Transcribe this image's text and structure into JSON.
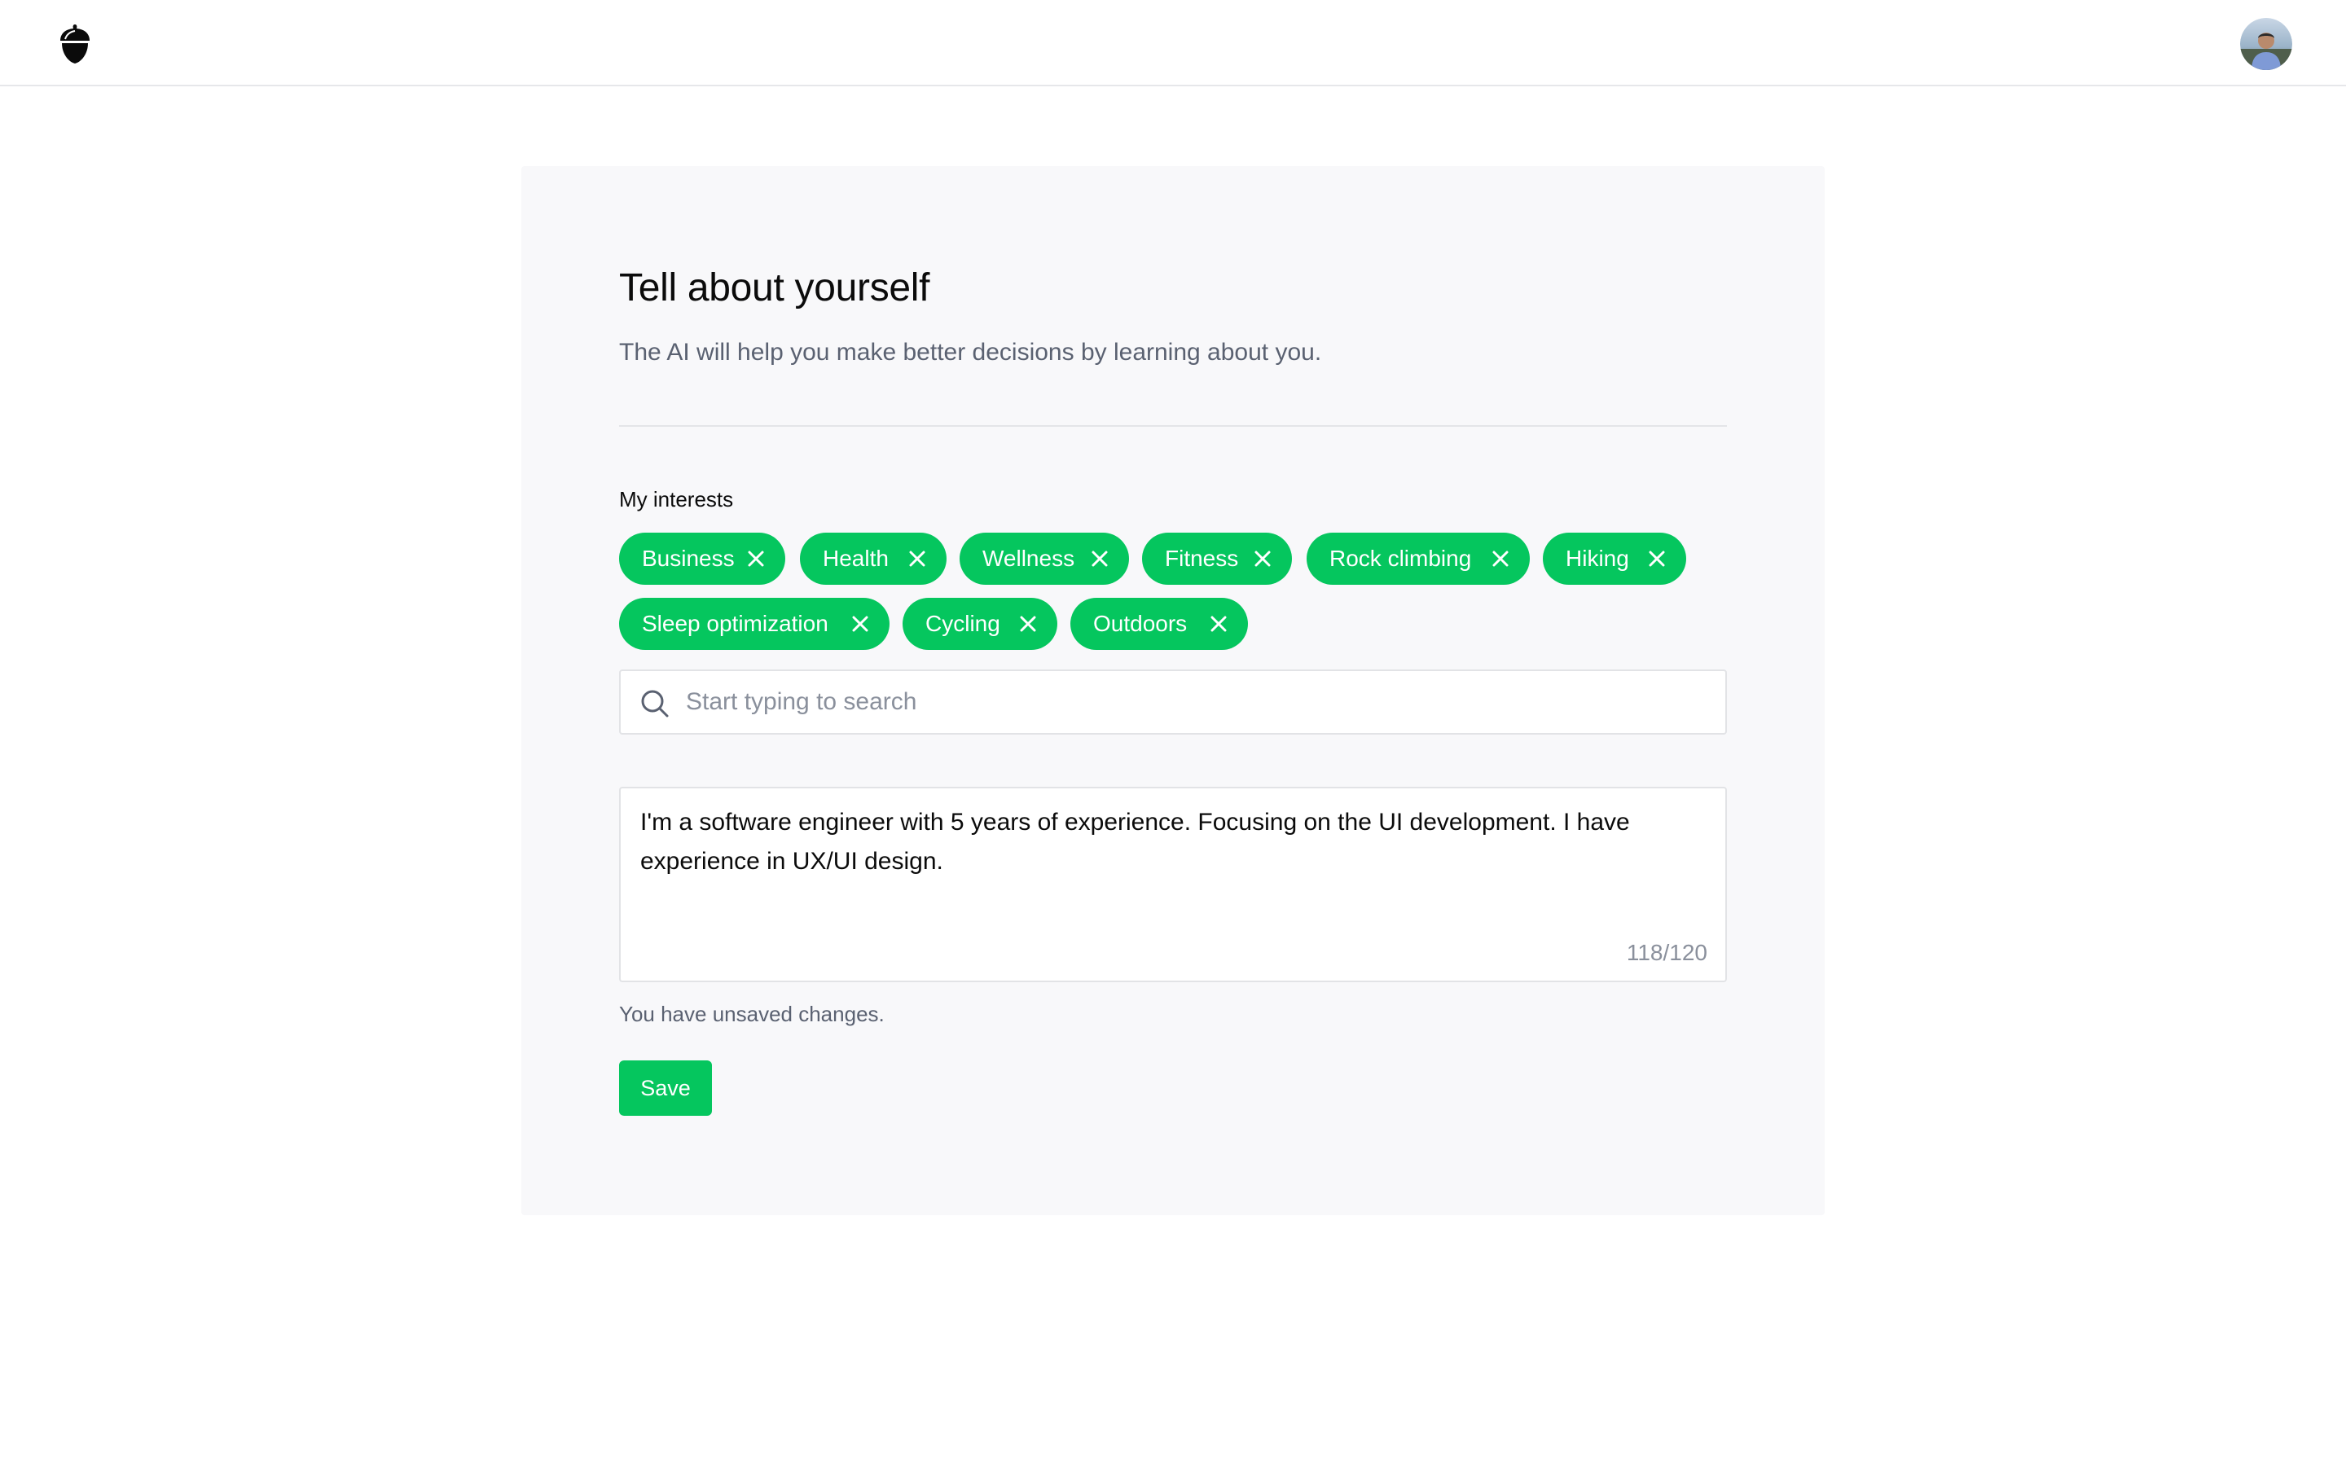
{
  "header": {
    "logo_icon": "acorn-icon",
    "avatar_icon": "user-avatar"
  },
  "card": {
    "title": "Tell about yourself",
    "subtitle": "The AI will help you make better decisions by learning about you.",
    "interests_label": "My interests",
    "interests": [
      {
        "label": "Business"
      },
      {
        "label": "Health"
      },
      {
        "label": "Wellness"
      },
      {
        "label": "Fitness"
      },
      {
        "label": "Rock climbing"
      },
      {
        "label": "Hiking"
      },
      {
        "label": "Sleep optimization"
      },
      {
        "label": "Cycling"
      },
      {
        "label": "Outdoors"
      }
    ],
    "remove_icon": "close-icon",
    "search": {
      "placeholder": "Start typing to search",
      "value": "",
      "icon": "search-icon"
    },
    "bio": {
      "text": "I'm a software engineer with 5 years of experience. Focusing on the UI development. I have experience in UX/UI design.",
      "counter": "118/120"
    },
    "status": "You have unsaved changes.",
    "save_label": "Save"
  },
  "colors": {
    "accent": "#05c65e",
    "card_background": "#f8f8fa",
    "muted_text": "#5a6171",
    "border": "#e2e3e6"
  }
}
